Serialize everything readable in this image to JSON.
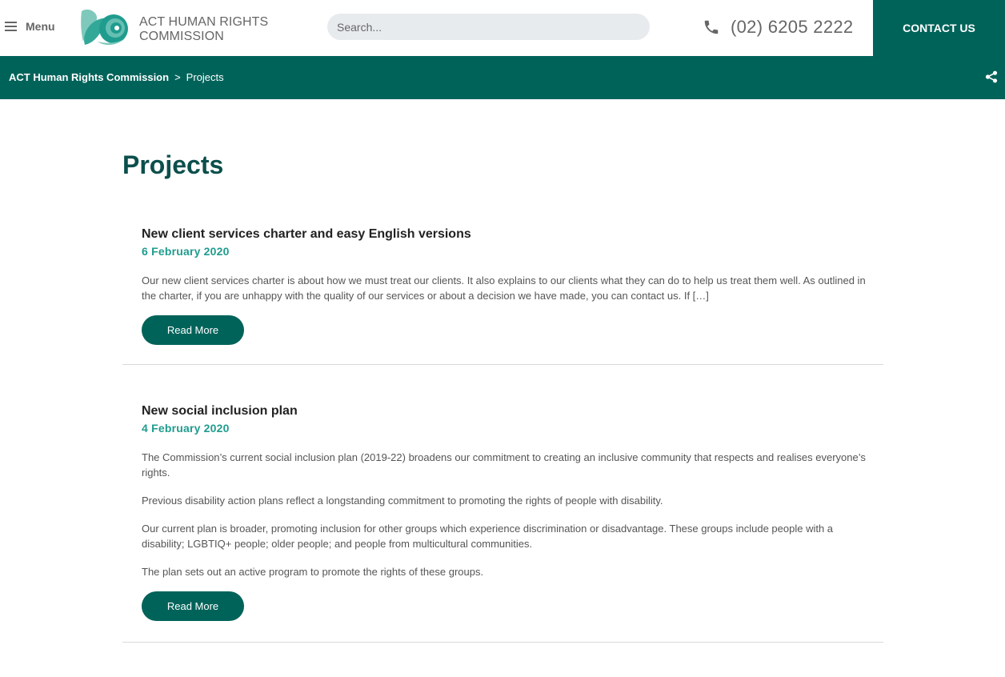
{
  "header": {
    "menu_label": "Menu",
    "org_name": "ACT HUMAN RIGHTS COMMISSION",
    "search_placeholder": "Search...",
    "phone_number": "(02) 6205 2222",
    "contact_label": "CONTACT US"
  },
  "breadcrumb": {
    "home": "ACT Human Rights Commission",
    "separator": ">",
    "current": "Projects"
  },
  "main": {
    "page_title": "Projects",
    "articles": [
      {
        "title": "New client services charter and easy English versions",
        "date": "6 February 2020",
        "paragraphs": [
          "Our new client services charter is about how we must treat our clients. It also explains to our clients what they can do to help us treat them well. As outlined in the charter, if you are unhappy with the quality of our services or about a decision we have made, you can contact us. If […]"
        ],
        "button_label": "Read More"
      },
      {
        "title": "New social inclusion plan",
        "date": "4 February 2020",
        "paragraphs": [
          "The Commission’s current social inclusion plan (2019-22) broadens our commitment to creating an inclusive community that respects and realises everyone’s rights.",
          "Previous disability action plans reflect a longstanding commitment to promoting the rights of people with disability.",
          "Our current plan is broader, promoting inclusion for other groups which experience discrimination or disadvantage. These groups include people with a disability; LGBTIQ+ people; older people; and people from multicultural communities.",
          "The plan sets out an active program to promote the rights of these groups."
        ],
        "button_label": "Read More"
      }
    ]
  },
  "colors": {
    "brand_green": "#00635a",
    "date_teal": "#1f9c8e",
    "title_dark": "#0b4f4c",
    "search_bg": "#e8ebee"
  },
  "icons": [
    "hamburger-icon",
    "logo-nautilus",
    "phone-icon",
    "share-icon"
  ]
}
